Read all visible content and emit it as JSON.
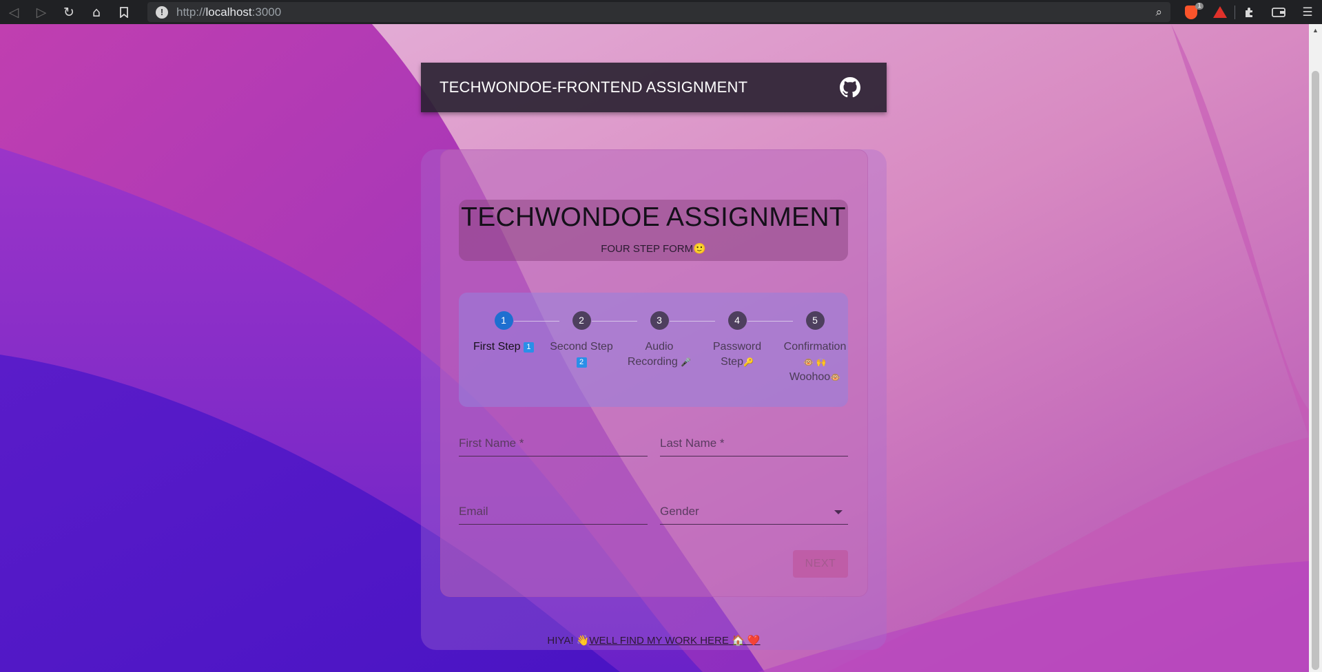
{
  "browser": {
    "url_scheme": "http://",
    "url_host": "localhost",
    "url_port": ":3000",
    "brave_badge_count": "1"
  },
  "header": {
    "title": "TECHWONDOE-FRONTEND ASSIGNMENT"
  },
  "hero": {
    "title": "TECHWONDOE ASSIGNMENT",
    "subtitle": "FOUR STEP FORM",
    "subtitle_emoji": "🙂"
  },
  "stepper": {
    "active_index": 0,
    "steps": [
      {
        "number": "1",
        "label": "First Step",
        "badge": "1"
      },
      {
        "number": "2",
        "label": "Second Step",
        "badge": "2"
      },
      {
        "number": "3",
        "label": "Audio Recording",
        "emoji": "🎤"
      },
      {
        "number": "4",
        "label": "Password Step",
        "emoji": "🔑"
      },
      {
        "number": "5",
        "label": "Confirmation",
        "emoji_pre": "🐵 🙌",
        "label2": "Woohoo",
        "emoji_post": "🐵"
      }
    ]
  },
  "form": {
    "first_name_placeholder": "First Name *",
    "last_name_placeholder": "Last Name *",
    "email_placeholder": "Email",
    "gender_placeholder": "Gender",
    "next_label": "NEXT"
  },
  "footer": {
    "prefix": "HIYA! ",
    "prefix_emoji": "👋",
    "link_text": "WELL FIND MY WORK HERE",
    "link_emoji": "🏠 ❤️"
  },
  "colors": {
    "active_step": "#1e6fd0",
    "header_bg": "#282030"
  }
}
